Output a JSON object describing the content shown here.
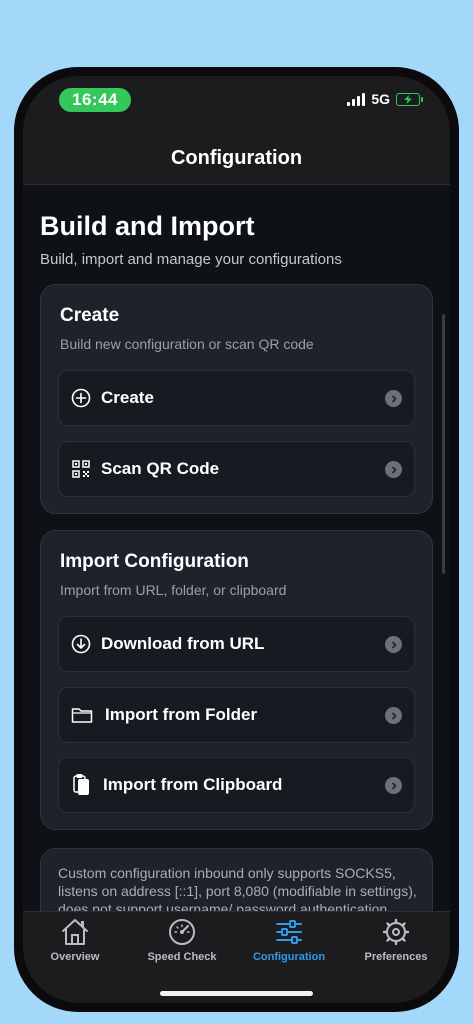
{
  "status": {
    "time": "16:44",
    "network": "5G"
  },
  "header": {
    "title": "Configuration"
  },
  "page": {
    "title": "Build and Import",
    "subtitle": "Build, import and manage your configurations"
  },
  "create_card": {
    "title": "Create",
    "subtitle": "Build new configuration or scan QR code",
    "items": [
      {
        "label": "Create",
        "icon": "plus-circle-icon"
      },
      {
        "label": "Scan QR Code",
        "icon": "qr-code-icon"
      }
    ]
  },
  "import_card": {
    "title": "Import Configuration",
    "subtitle": "Import from URL, folder, or clipboard",
    "items": [
      {
        "label": "Download from URL",
        "icon": "download-circle-icon"
      },
      {
        "label": "Import from Folder",
        "icon": "folder-icon"
      },
      {
        "label": "Import from Clipboard",
        "icon": "clipboard-icon"
      }
    ]
  },
  "note": {
    "text": "Custom configuration inbound only supports SOCKS5, listens on address [::1], port 8,080 (modifiable in settings), does not support username/ password authentication"
  },
  "tabs": [
    {
      "label": "Overview",
      "icon": "house-icon",
      "active": false
    },
    {
      "label": "Speed Check",
      "icon": "speedometer-icon",
      "active": false
    },
    {
      "label": "Configuration",
      "icon": "sliders-icon",
      "active": true
    },
    {
      "label": "Preferences",
      "icon": "gear-icon",
      "active": false
    }
  ],
  "colors": {
    "background": "#a3d8fb",
    "accent": "#2b9bea",
    "status_pill": "#34c759",
    "card": "#1d222b"
  }
}
